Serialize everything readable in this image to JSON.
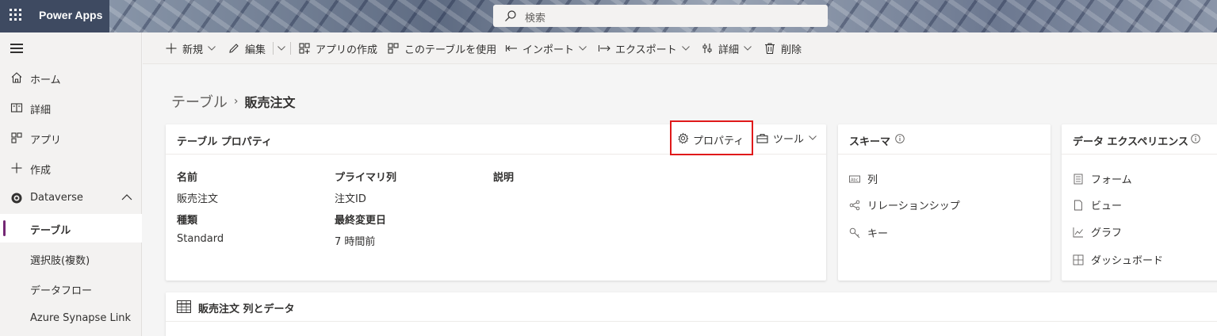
{
  "header": {
    "app_name": "Power Apps",
    "search_placeholder": "検索"
  },
  "sidebar": {
    "items": [
      {
        "label": "ホーム"
      },
      {
        "label": "詳細"
      },
      {
        "label": "アプリ"
      },
      {
        "label": "作成"
      },
      {
        "label": "Dataverse"
      },
      {
        "label": "テーブル"
      },
      {
        "label": "選択肢(複数)"
      },
      {
        "label": "データフロー"
      },
      {
        "label": "Azure Synapse Link"
      }
    ]
  },
  "commandbar": {
    "new": "新規",
    "edit": "編集",
    "create_app": "アプリの作成",
    "use_table": "このテーブルを使用",
    "import": "インポート",
    "export": "エクスポート",
    "details": "詳細",
    "delete": "削除"
  },
  "breadcrumb": {
    "root": "テーブル",
    "separator": "›",
    "current": "販売注文"
  },
  "table_props": {
    "title": "テーブル プロパティ",
    "properties_button": "プロパティ",
    "tools_button": "ツール",
    "fields": {
      "name_label": "名前",
      "name_value": "販売注文",
      "type_label": "種類",
      "type_value": "Standard",
      "primary_col_label": "プライマリ列",
      "primary_col_value": "注文ID",
      "modified_label": "最終変更日",
      "modified_value": "7 時間前",
      "description_label": "説明"
    }
  },
  "schema": {
    "title": "スキーマ",
    "items": [
      "列",
      "リレーションシップ",
      "キー"
    ]
  },
  "data_experiences": {
    "title": "データ エクスペリエンス",
    "items": [
      "フォーム",
      "ビュー",
      "グラフ",
      "ダッシュボード"
    ]
  },
  "columns_data": {
    "title": "販売注文 列とデータ"
  },
  "colors": {
    "header_bg": "#3e4a61",
    "accent_purple": "#742774",
    "highlight_red": "#e0191a"
  }
}
